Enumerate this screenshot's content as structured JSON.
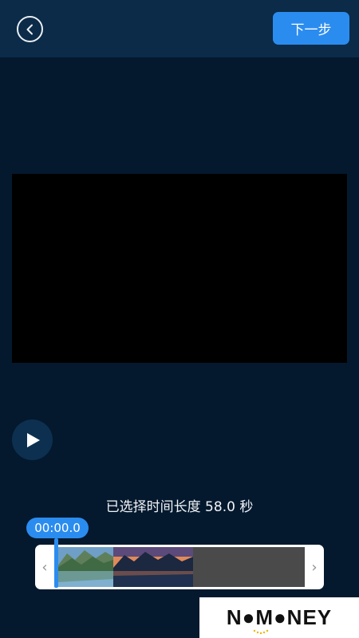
{
  "header": {
    "next_label": "下一步",
    "back_icon": "chevron-left-icon"
  },
  "player": {
    "play_icon": "play-icon"
  },
  "trim": {
    "selected_duration_label": "已选择时间长度 58.0 秒",
    "current_time": "00:00.0",
    "left_handle": "‹",
    "right_handle": "›"
  },
  "watermark": {
    "logo_text": "NOMONEY"
  },
  "colors": {
    "background": "#04192e",
    "header": "#0b2b48",
    "accent": "#2b8cf0"
  }
}
